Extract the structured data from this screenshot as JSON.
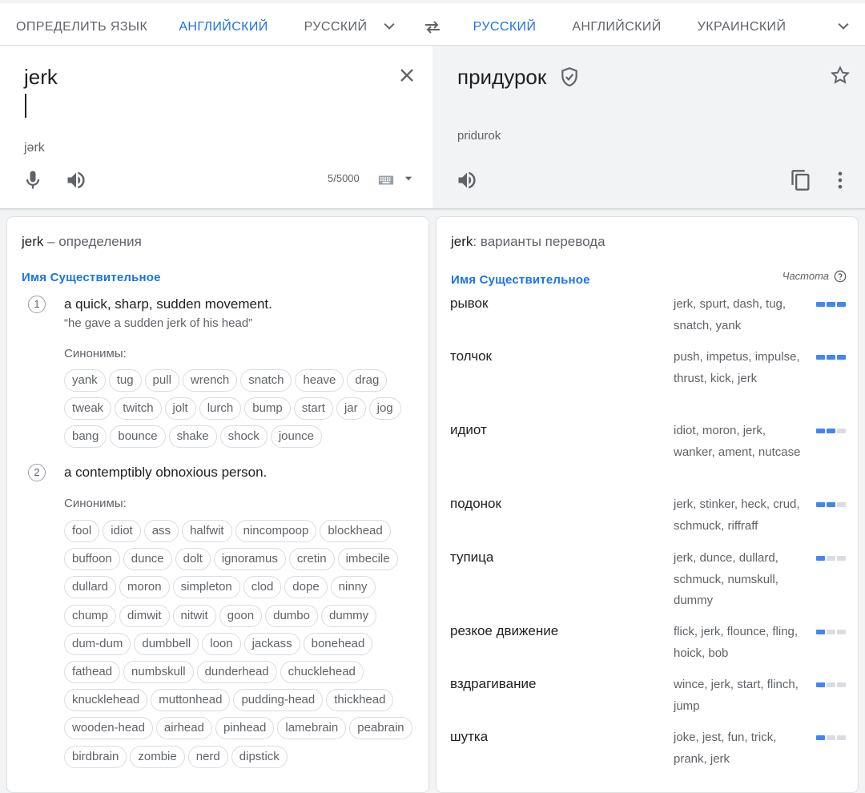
{
  "lang_bar": {
    "source_tabs": [
      "Определить язык",
      "Английский",
      "Русский"
    ],
    "source_active": "Английский",
    "target_tabs": [
      "Русский",
      "Английский",
      "Украинский"
    ],
    "target_active": "Русский"
  },
  "source": {
    "text": "jerk",
    "transliteration": "jərk",
    "char_count": "5/5000"
  },
  "target": {
    "text": "придурок",
    "transliteration": "pridurok"
  },
  "definitions": {
    "word": "jerk",
    "title_suffix": " – определения",
    "part_of_speech": "Имя Существительное",
    "synonyms_label": "Синонимы:",
    "items": [
      {
        "num": "1",
        "text": "a quick, sharp, sudden movement.",
        "example": "“he gave a sudden jerk of his head”",
        "synonyms": [
          "yank",
          "tug",
          "pull",
          "wrench",
          "snatch",
          "heave",
          "drag",
          "tweak",
          "twitch",
          "jolt",
          "lurch",
          "bump",
          "start",
          "jar",
          "jog",
          "bang",
          "bounce",
          "shake",
          "shock",
          "jounce"
        ]
      },
      {
        "num": "2",
        "text": "a contemptibly obnoxious person.",
        "synonyms": [
          "fool",
          "idiot",
          "ass",
          "halfwit",
          "nincompoop",
          "blockhead",
          "buffoon",
          "dunce",
          "dolt",
          "ignoramus",
          "cretin",
          "imbecile",
          "dullard",
          "moron",
          "simpleton",
          "clod",
          "dope",
          "ninny",
          "chump",
          "dimwit",
          "nitwit",
          "goon",
          "dumbo",
          "dummy",
          "dum-dum",
          "dumbbell",
          "loon",
          "jackass",
          "bonehead",
          "fathead",
          "numbskull",
          "dunderhead",
          "chucklehead",
          "knucklehead",
          "muttonhead",
          "pudding-head",
          "thickhead",
          "wooden-head",
          "airhead",
          "pinhead",
          "lamebrain",
          "peabrain",
          "birdbrain",
          "zombie",
          "nerd",
          "dipstick"
        ]
      }
    ]
  },
  "translations": {
    "word": "jerk",
    "title_suffix": ": варианты перевода",
    "part_of_speech": "Имя Существительное",
    "frequency_label": "Частота",
    "rows": [
      {
        "word": "рывок",
        "alts": "jerk, spurt, dash, tug, snatch, yank",
        "freq": 3
      },
      {
        "word": "толчок",
        "alts": "push, impetus, impulse, thrust, kick, jerk",
        "freq": 3
      },
      {
        "word": "идиот",
        "alts": "idiot, moron, jerk, wanker, ament, nutcase",
        "freq": 2
      },
      {
        "word": "подонок",
        "alts": "jerk, stinker, heck, crud, schmuck, riffraff",
        "freq": 2
      },
      {
        "word": "тупица",
        "alts": "jerk, dunce, dullard, schmuck, numskull, dummy",
        "freq": 1
      },
      {
        "word": "резкое движение",
        "alts": "flick, jerk, flounce, fling, hoick, bob",
        "freq": 1
      },
      {
        "word": "вздрагивание",
        "alts": "wince, jerk, start, flinch, jump",
        "freq": 1
      },
      {
        "word": "шутка",
        "alts": "joke, jest, fun, trick, prank, jerk",
        "freq": 1
      }
    ]
  },
  "colors": {
    "accent": "#1a73e8",
    "freq_on": "#4285f4",
    "freq_off": "#dadce0"
  }
}
